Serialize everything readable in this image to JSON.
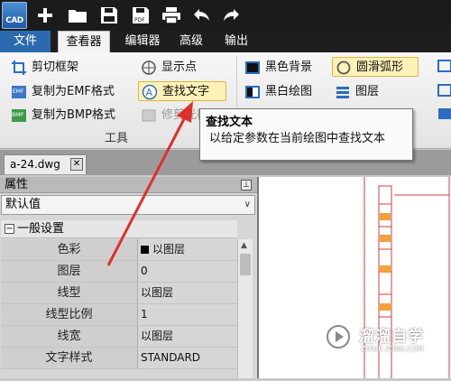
{
  "app": {
    "logo_text": "CAD"
  },
  "quick_toolbar": [
    "new-icon",
    "open-folder-icon",
    "save-icon",
    "save-pdf-icon",
    "print-icon",
    "undo-icon",
    "redo-icon"
  ],
  "menu": {
    "tabs": [
      {
        "label": "文件"
      },
      {
        "label": "查看器",
        "active": true
      },
      {
        "label": "编辑器"
      },
      {
        "label": "高级"
      },
      {
        "label": "输出"
      }
    ]
  },
  "ribbon": {
    "buttons": [
      {
        "label": "剪切框架",
        "icon": "crop-frame-icon"
      },
      {
        "label": "复制为EMF格式",
        "icon": "copy-emf-icon"
      },
      {
        "label": "复制为BMP格式",
        "icon": "copy-bmp-icon"
      },
      {
        "label": "显示点",
        "icon": "show-points-icon"
      },
      {
        "label": "查找文字",
        "icon": "find-text-icon"
      },
      {
        "label": "修剪光栅",
        "icon": "trim-raster-icon"
      },
      {
        "label": "黑色背景",
        "icon": "black-background-icon"
      },
      {
        "label": "黑白绘图",
        "icon": "black-white-icon"
      },
      {
        "label": "圆滑弧形",
        "icon": "smooth-arc-icon"
      },
      {
        "label": "图层",
        "icon": "layers-icon"
      }
    ],
    "group_label": "工具"
  },
  "tooltip": {
    "title": "查找文本",
    "body": "以给定参数在当前绘图中查找文本"
  },
  "document": {
    "tab_label": "a-24.dwg"
  },
  "properties": {
    "header": "属性",
    "pin": "-⃞",
    "dropdown_value": "默认值",
    "section_label": "一般设置",
    "rows": [
      {
        "key": "色彩",
        "value": "以图层",
        "swatch": "#000000"
      },
      {
        "key": "图层",
        "value": "0"
      },
      {
        "key": "线型",
        "value": "以图层"
      },
      {
        "key": "线型比例",
        "value": "1"
      },
      {
        "key": "线宽",
        "value": "以图层"
      },
      {
        "key": "文字样式",
        "value": "STANDARD"
      }
    ]
  },
  "watermark": {
    "brand": "溜溜自学",
    "url": "ZIXUE.3D66.COM"
  },
  "colors": {
    "accent_blue": "#2c6ab0",
    "annotation_red": "#e0302a",
    "drawing_red": "#d43c3c",
    "drawing_orange": "#f2a03a"
  }
}
